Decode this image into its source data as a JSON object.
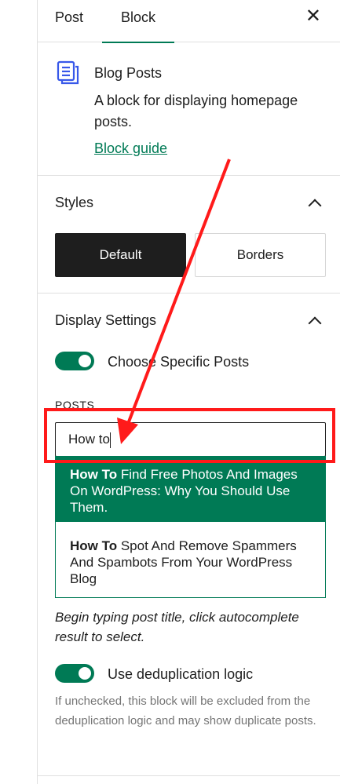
{
  "tabs": {
    "post_label": "Post",
    "block_label": "Block",
    "close_glyph": "✕"
  },
  "block_card": {
    "icon": "blog-posts-icon",
    "title": "Blog Posts",
    "description": "A block for displaying homepage posts.",
    "guide_link": "Block guide"
  },
  "styles_panel": {
    "title": "Styles",
    "options": [
      "Default",
      "Borders"
    ],
    "selected": "Default"
  },
  "display_settings": {
    "title": "Display Settings",
    "specific_posts_toggle": {
      "label": "Choose Specific Posts",
      "on": true
    },
    "posts_label": "POSTS",
    "posts_input_value": "How to",
    "suggestions": [
      {
        "match": "How To",
        "rest": " Find Free Photos And Images On WordPress: Why You Should Use Them.",
        "highlighted": true
      },
      {
        "match": "How To",
        "rest": " Spot And Remove Spammers And Spambots From Your WordPress Blog",
        "highlighted": false
      }
    ],
    "autocomplete_help": "Begin typing post title, click autocomplete result to select.",
    "dedup_toggle": {
      "label": "Use deduplication logic",
      "on": true
    },
    "dedup_help": "If unchecked, this block will be excluded from the deduplication logic and may show duplicate posts."
  },
  "colors": {
    "accent": "#007a55",
    "annotation": "#ff1a1a",
    "text": "#1e1e1e",
    "muted": "#757575"
  }
}
